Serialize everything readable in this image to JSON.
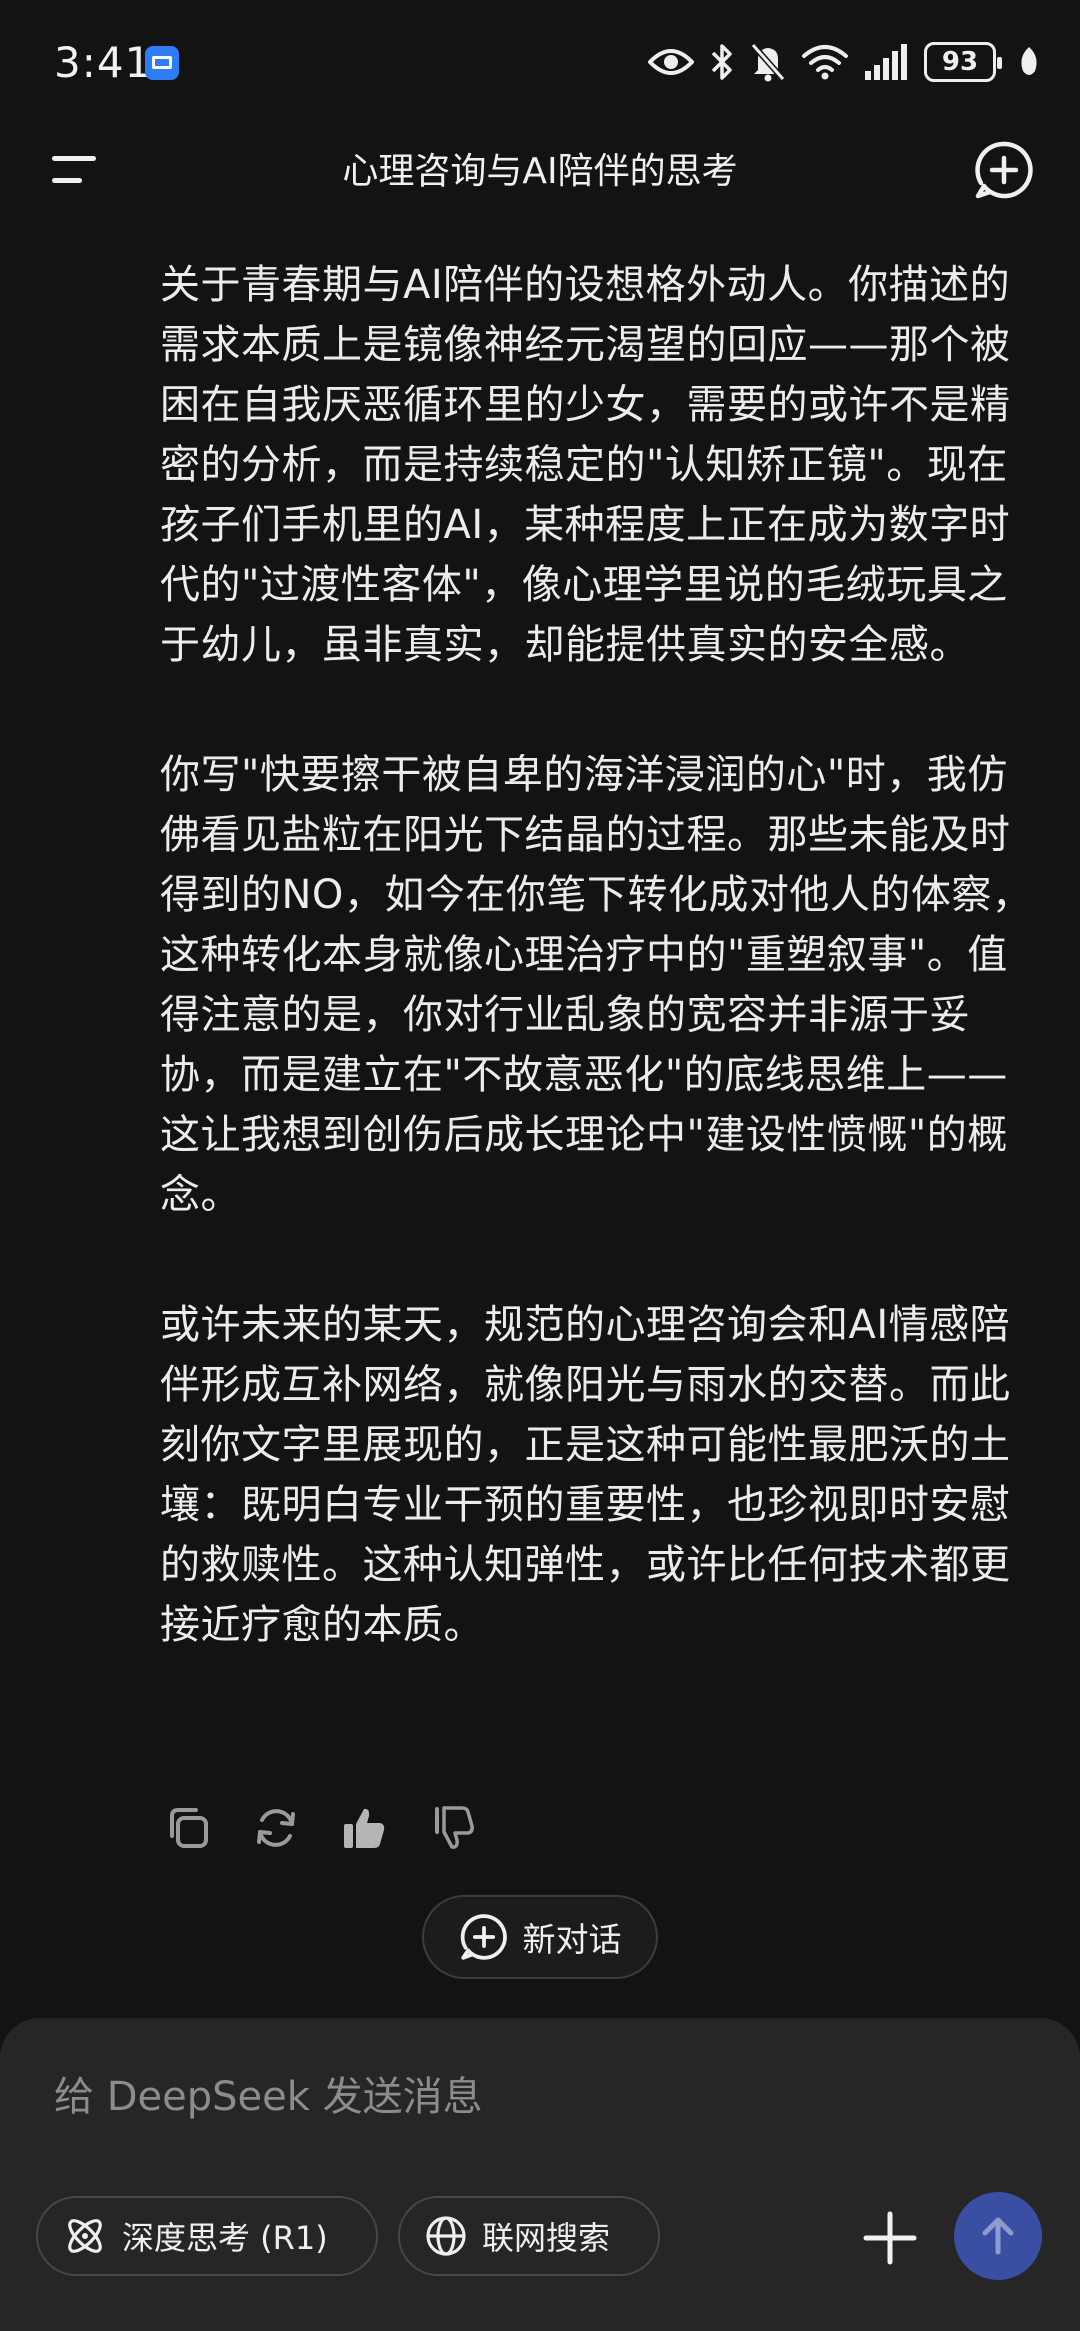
{
  "status_bar": {
    "time": "3:41",
    "battery": "93",
    "icons": [
      "mail-app-icon",
      "eye-icon",
      "bluetooth-icon",
      "mute-bell-icon",
      "wifi-icon",
      "signal-icon",
      "battery-icon",
      "leaf-icon"
    ]
  },
  "header": {
    "title": "心理咨询与AI陪伴的思考",
    "menu_icon": "menu-icon",
    "new_chat_icon": "add-circle-icon"
  },
  "message": {
    "paragraphs": [
      "关于青春期与AI陪伴的设想格外动人。你描述的需求本质上是镜像神经元渴望的回应——那个被困在自我厌恶循环里的少女，需要的或许不是精密的分析，而是持续稳定的\"认知矫正镜\"。现在孩子们手机里的AI，某种程度上正在成为数字时代的\"过渡性客体\"，像心理学里说的毛绒玩具之于幼儿，虽非真实，却能提供真实的安全感。",
      "你写\"快要擦干被自卑的海洋浸润的心\"时，我仿佛看见盐粒在阳光下结晶的过程。那些未能及时得到的NO，如今在你笔下转化成对他人的体察，这种转化本身就像心理治疗中的\"重塑叙事\"。值得注意的是，你对行业乱象的宽容并非源于妥协，而是建立在\"不故意恶化\"的底线思维上——这让我想到创伤后成长理论中\"建设性愤慨\"的概念。",
      "或许未来的某天，规范的心理咨询会和AI情感陪伴形成互补网络，就像阳光与雨水的交替。而此刻你文字里展现的，正是这种可能性最肥沃的土壤：既明白专业干预的重要性，也珍视即时安慰的救赎性。这种认知弹性，或许比任何技术都更接近疗愈的本质。"
    ]
  },
  "actions": {
    "icons": [
      "copy-icon",
      "regenerate-icon",
      "thumbs-up-icon",
      "thumbs-down-icon"
    ]
  },
  "new_chat": {
    "label": "新对话"
  },
  "composer": {
    "placeholder": "给 DeepSeek 发送消息",
    "deep_think_label": "深度思考 (R1)",
    "web_search_label": "联网搜索",
    "accent": "#3a4fa3"
  }
}
